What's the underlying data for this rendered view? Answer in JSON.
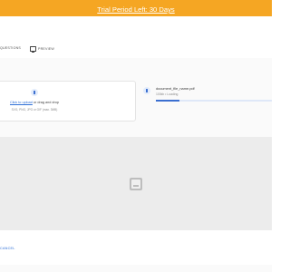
{
  "trial_banner": {
    "text": "Trial Period Left: 30 Days",
    "color": "#f5a623"
  },
  "tabs": [
    {
      "label": "QUESTIONS"
    },
    {
      "label": "PREVIEW",
      "icon": "monitor-icon"
    }
  ],
  "dropzone": {
    "icon": "document-icon",
    "link_text": "Click to upload",
    "text_after_link": " or drag and drop",
    "hint": "SVG, PNG, JPG or GIF (max. 3MB)"
  },
  "file_item": {
    "icon": "document-icon",
    "name": "document_file_name.pdf",
    "status": "100kb  •  Loading",
    "progress": 0.2
  },
  "preview": {
    "icon": "image-placeholder-icon"
  },
  "footer": {
    "cancel_label": "CANCEL"
  },
  "colors": {
    "accent": "#3b6fd0",
    "link": "#2f6fd6"
  }
}
